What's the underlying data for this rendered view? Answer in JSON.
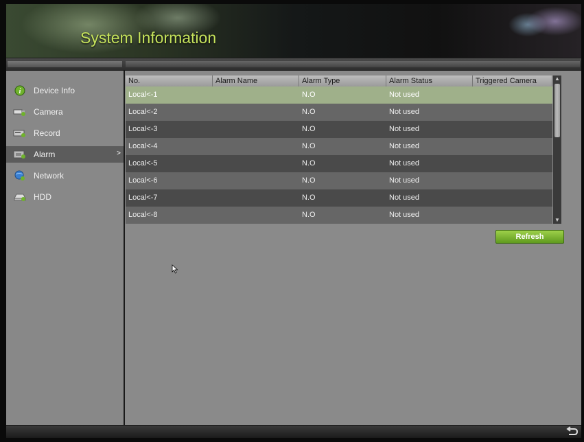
{
  "header": {
    "title": "System Information"
  },
  "sidebar": {
    "items": [
      {
        "label": "Device Info",
        "icon": "info-icon",
        "active": false
      },
      {
        "label": "Camera",
        "icon": "camera-icon",
        "active": false
      },
      {
        "label": "Record",
        "icon": "record-icon",
        "active": false
      },
      {
        "label": "Alarm",
        "icon": "alarm-icon",
        "active": true,
        "arrow": ">"
      },
      {
        "label": "Network",
        "icon": "network-icon",
        "active": false
      },
      {
        "label": "HDD",
        "icon": "hdd-icon",
        "active": false
      }
    ]
  },
  "table": {
    "columns": [
      "No.",
      "Alarm Name",
      "Alarm Type",
      "Alarm Status",
      "Triggered Camera"
    ],
    "rows": [
      [
        "Local<-1",
        "",
        "N.O",
        "Not used",
        ""
      ],
      [
        "Local<-2",
        "",
        "N.O",
        "Not used",
        ""
      ],
      [
        "Local<-3",
        "",
        "N.O",
        "Not used",
        ""
      ],
      [
        "Local<-4",
        "",
        "N.O",
        "Not used",
        ""
      ],
      [
        "Local<-5",
        "",
        "N.O",
        "Not used",
        ""
      ],
      [
        "Local<-6",
        "",
        "N.O",
        "Not used",
        ""
      ],
      [
        "Local<-7",
        "",
        "N.O",
        "Not used",
        ""
      ],
      [
        "Local<-8",
        "",
        "N.O",
        "Not used",
        ""
      ]
    ],
    "selected_row": 0
  },
  "buttons": {
    "refresh": "Refresh"
  },
  "colors": {
    "accent": "#c6e35c",
    "button": "#7ab530",
    "selected_row": "#9fb08a"
  }
}
